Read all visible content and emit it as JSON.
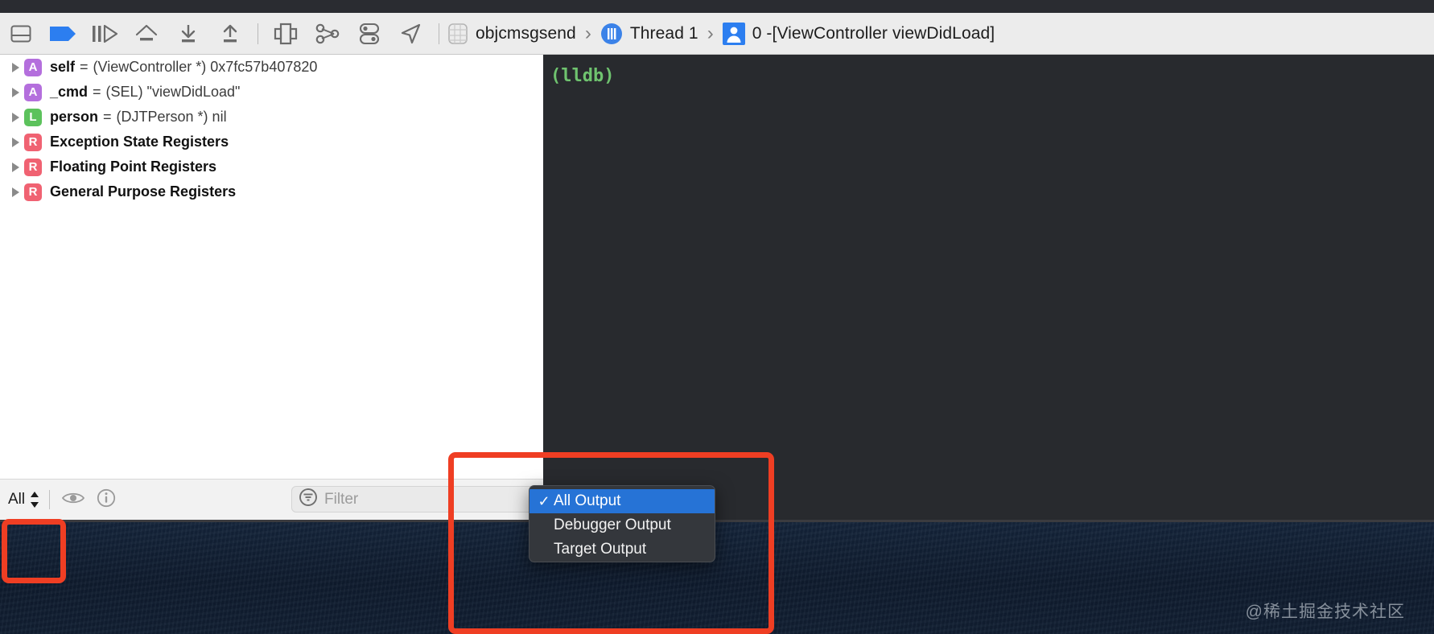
{
  "toolbar": {
    "buttons": [
      {
        "name": "hide-debug-area-icon",
        "label": "Hide Debug Area"
      },
      {
        "name": "breakpoints-toggle-icon",
        "label": "Activate Breakpoints"
      },
      {
        "name": "continue-icon",
        "label": "Continue program execution"
      },
      {
        "name": "step-over-icon",
        "label": "Step Over"
      },
      {
        "name": "step-into-icon",
        "label": "Step Into"
      },
      {
        "name": "step-out-icon",
        "label": "Step Out"
      },
      {
        "name": "debug-view-hierarchy-icon",
        "label": "Debug View Hierarchy"
      },
      {
        "name": "memory-graph-icon",
        "label": "Debug Memory Graph"
      },
      {
        "name": "environment-overrides-icon",
        "label": "Environment Overrides"
      },
      {
        "name": "simulate-location-icon",
        "label": "Simulate Location"
      }
    ],
    "breadcrumb": [
      {
        "icon": "process-grid-icon",
        "label": "objcmsgsend"
      },
      {
        "icon": "thread-icon",
        "label": "Thread 1"
      },
      {
        "icon": "person-frame-icon",
        "label": "0 -[ViewController viewDidLoad]"
      }
    ],
    "breadcrumb_separator": "›"
  },
  "variables": {
    "rows": [
      {
        "badge": "A",
        "badge_class": "badge-A",
        "name": "self",
        "eq": "=",
        "value": "(ViewController *) 0x7fc57b407820",
        "is_group": false
      },
      {
        "badge": "A",
        "badge_class": "badge-A",
        "name": "_cmd",
        "eq": "=",
        "value": "(SEL) \"viewDidLoad\"",
        "is_group": false
      },
      {
        "badge": "L",
        "badge_class": "badge-L",
        "name": "person",
        "eq": "=",
        "value": "(DJTPerson *) nil",
        "is_group": false
      },
      {
        "badge": "R",
        "badge_class": "badge-R",
        "name": "Exception State Registers",
        "eq": "",
        "value": "",
        "is_group": true
      },
      {
        "badge": "R",
        "badge_class": "badge-R",
        "name": "Floating Point Registers",
        "eq": "",
        "value": "",
        "is_group": true
      },
      {
        "badge": "R",
        "badge_class": "badge-R",
        "name": "General Purpose Registers",
        "eq": "",
        "value": "",
        "is_group": true
      }
    ]
  },
  "bottom_bar": {
    "scope_label": "All",
    "eye_icon": "eye-icon",
    "info_icon": "info-icon",
    "filter_placeholder": "Filter"
  },
  "console": {
    "prompt": "(lldb)"
  },
  "output_menu": {
    "items": [
      {
        "label": "All Output",
        "checked": true
      },
      {
        "label": "Debugger Output",
        "checked": false
      },
      {
        "label": "Target Output",
        "checked": false
      }
    ],
    "check_glyph": "✓"
  },
  "watermark": {
    "text": "@稀土掘金技术社区"
  },
  "colors": {
    "accent_blue": "#2673d6",
    "annotation_red": "#ef3e23",
    "console_bg": "#282a2e",
    "console_green": "#6fc36f",
    "badge_argument": "#b46fdd",
    "badge_local": "#5cc25c",
    "badge_register": "#f06272"
  }
}
